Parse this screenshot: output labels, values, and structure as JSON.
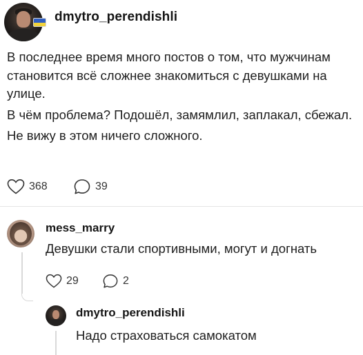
{
  "post": {
    "username": "dmytro_perendishli",
    "paragraphs": [
      "В последнее время много постов о том, что мужчинам становится всё сложнее знакомиться с девушками на улице.",
      "В чём проблема? Подошёл, замямлил, заплакал, сбежал.",
      "Не вижу в этом ничего сложного."
    ],
    "likes": "368",
    "comments": "39"
  },
  "comment": {
    "username": "mess_marry",
    "text": "Девушки стали спортивными, могут и догнать",
    "likes": "29",
    "comments": "2"
  },
  "reply": {
    "username": "dmytro_perendishli",
    "text": "Надо страховаться самокатом"
  },
  "icons": {
    "like": "heart-outline-icon",
    "comment": "speech-bubble-icon",
    "badge": "ukraine-flag-icon"
  },
  "colors": {
    "text": "#1e1e1e",
    "muted": "#333333",
    "line": "#d9d9d9"
  }
}
